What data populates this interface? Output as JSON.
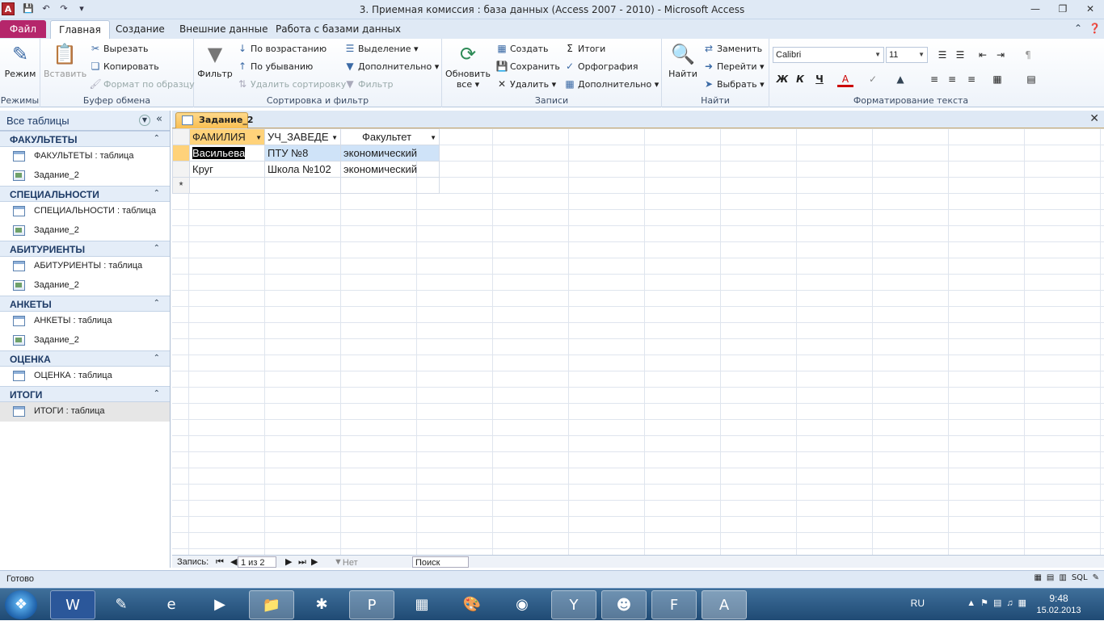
{
  "window": {
    "title": "3. Приемная комиссия : база данных (Access 2007 - 2010)  -  Microsoft Access",
    "app_icon": "A"
  },
  "tabs": {
    "file": "Файл",
    "items": [
      "Главная",
      "Создание",
      "Внешние данные",
      "Работа с базами данных"
    ]
  },
  "ribbon": {
    "views": {
      "mode": "Режим",
      "label": "Режимы"
    },
    "clipboard": {
      "paste": "Вставить",
      "cut": "Вырезать",
      "copy": "Копировать",
      "format_painter": "Формат по образцу",
      "label": "Буфер обмена"
    },
    "sort": {
      "filter": "Фильтр",
      "asc": "По возрастанию",
      "desc": "По убыванию",
      "remove_sort": "Удалить сортировку",
      "selection": "Выделение",
      "advanced": "Дополнительно",
      "toggle_filter": "Фильтр",
      "label": "Сортировка и фильтр"
    },
    "records": {
      "refresh": "Обновить",
      "refresh2": "все",
      "new": "Создать",
      "save": "Сохранить",
      "delete": "Удалить",
      "totals": "Итоги",
      "spelling": "Орфография",
      "more": "Дополнительно",
      "label": "Записи"
    },
    "find": {
      "find": "Найти",
      "replace": "Заменить",
      "goto": "Перейти",
      "select": "Выбрать",
      "label": "Найти"
    },
    "text": {
      "font": "Calibri",
      "size": "11",
      "bold": "Ж",
      "italic": "К",
      "underline": "Ч",
      "label": "Форматирование текста"
    }
  },
  "nav": {
    "header": "Все таблицы",
    "groups": [
      {
        "name": "ФАКУЛЬТЕТЫ",
        "items": [
          "ФАКУЛЬТЕТЫ : таблица",
          "Задание_2"
        ]
      },
      {
        "name": "СПЕЦИАЛЬНОСТИ",
        "items": [
          "СПЕЦИАЛЬНОСТИ : таблица",
          "Задание_2"
        ]
      },
      {
        "name": "АБИТУРИЕНТЫ",
        "items": [
          "АБИТУРИЕНТЫ : таблица",
          "Задание_2"
        ]
      },
      {
        "name": "АНКЕТЫ",
        "items": [
          "АНКЕТЫ : таблица",
          "Задание_2"
        ]
      },
      {
        "name": "ОЦЕНКА",
        "items": [
          "ОЦЕНКА : таблица"
        ]
      },
      {
        "name": "ИТОГИ",
        "items": [
          "ИТОГИ : таблица"
        ]
      }
    ]
  },
  "document": {
    "tab": "Задание_2",
    "columns": [
      "ФАМИЛИЯ",
      "УЧ_ЗАВЕДЕ",
      "Факультет"
    ],
    "rows": [
      [
        "Васильева",
        "ПТУ №8",
        "экономический"
      ],
      [
        "Круг",
        "Школа №102",
        "экономический"
      ]
    ],
    "new_row_marker": "*"
  },
  "recnav": {
    "label": "Запись:",
    "position": "1 из 2",
    "filter": "Нет фильтра",
    "search": "Поиск"
  },
  "status": {
    "text": "Готово"
  },
  "taskbar": {
    "lang": "RU",
    "time": "9:48",
    "date": "15.02.2013"
  },
  "colors": {
    "file_tab": "#b5266b",
    "selected_header": "#ffd27a",
    "selected_row": "#cfe3f8",
    "taskbar": "#1f4a74"
  }
}
